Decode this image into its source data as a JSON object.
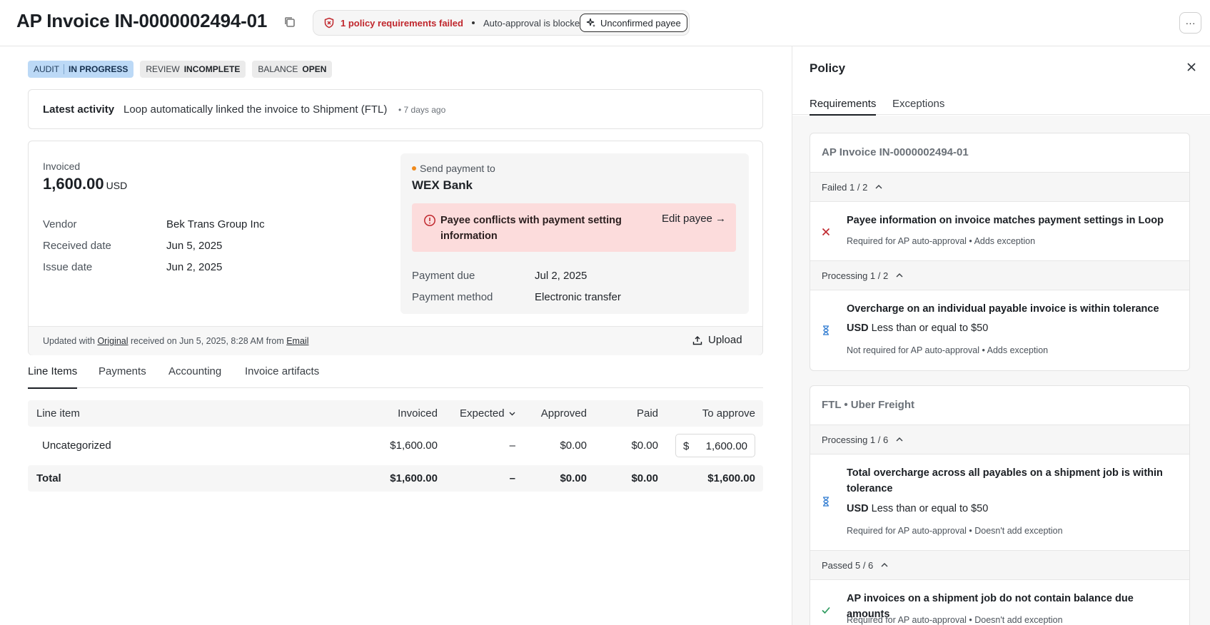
{
  "header": {
    "title": "AP Invoice IN-0000002494-01",
    "policy_failed": "1 policy requirements failed",
    "auto_approval": "Auto-approval is blocked",
    "unconfirmed_payee": "Unconfirmed payee",
    "more": "···"
  },
  "badges": {
    "audit_key": "AUDIT",
    "audit_val": "IN PROGRESS",
    "review_key": "REVIEW",
    "review_val": "INCOMPLETE",
    "balance_key": "BALANCE",
    "balance_val": "OPEN"
  },
  "activity": {
    "label": "Latest activity",
    "message": "Loop automatically linked the invoice to Shipment (FTL)",
    "ago": "7 days ago"
  },
  "invoice": {
    "invoiced_label": "Invoiced",
    "amount": "1,600.00",
    "currency": "USD",
    "vendor_label": "Vendor",
    "vendor": "Bek Trans Group Inc",
    "received_label": "Received date",
    "received": "Jun 5, 2025",
    "issue_label": "Issue date",
    "issue": "Jun 2, 2025"
  },
  "payment": {
    "send_label": "Send payment to",
    "bank": "WEX Bank",
    "conflict": "Payee conflicts with payment setting information",
    "edit_payee": "Edit payee →",
    "due_label": "Payment due",
    "due": "Jul 2, 2025",
    "method_label": "Payment method",
    "method": "Electronic transfer"
  },
  "footer": {
    "updated_prefix": "Updated with",
    "original": "Original",
    "received_on": "received on Jun 5, 2025, 8:28 AM from",
    "email": "Email",
    "upload": "Upload"
  },
  "tabs": [
    "Line Items",
    "Payments",
    "Accounting",
    "Invoice artifacts"
  ],
  "table": {
    "headers": [
      "Line item",
      "Invoiced",
      "Expected",
      "Approved",
      "Paid",
      "To approve"
    ],
    "row": [
      "Uncategorized",
      "$1,600.00",
      "–",
      "$0.00",
      "$0.00"
    ],
    "to_approve_currency": "$",
    "to_approve_value": "1,600.00",
    "total": [
      "Total",
      "$1,600.00",
      "–",
      "$0.00",
      "$0.00",
      "$1,600.00"
    ]
  },
  "panel": {
    "title": "Policy",
    "tabs": [
      "Requirements",
      "Exceptions"
    ],
    "group1": {
      "title": "AP Invoice IN-0000002494-01",
      "failed": "Failed 1 / 2",
      "req1_title": "Payee information on invoice matches payment settings in Loop",
      "req1_note": "Required for AP auto-approval • Adds exception",
      "processing": "Processing 1 / 2",
      "req2_title": "Overcharge on an individual payable invoice is within tolerance",
      "req2_cur": "USD",
      "req2_line": "Less than or equal to $50",
      "req2_note": "Not required for AP auto-approval • Adds exception"
    },
    "group2": {
      "title": "FTL • Uber Freight",
      "processing": "Processing 1 / 6",
      "req3_title": "Total overcharge across all payables on a shipment job is within tolerance",
      "req3_cur": "USD",
      "req3_line": "Less than or equal to $50",
      "req3_note": "Required for AP auto-approval • Doesn't add exception",
      "passed": "Passed 5 / 6",
      "req4_title": "AP invoices on a shipment job do not contain balance due amounts",
      "req4_note": "Required for AP auto-approval • Doesn't add exception"
    }
  },
  "colors": {
    "fail": "#c0272d",
    "processing": "#2f7bd1",
    "passed": "#2e9b5f",
    "accent": "#1b1f24"
  }
}
